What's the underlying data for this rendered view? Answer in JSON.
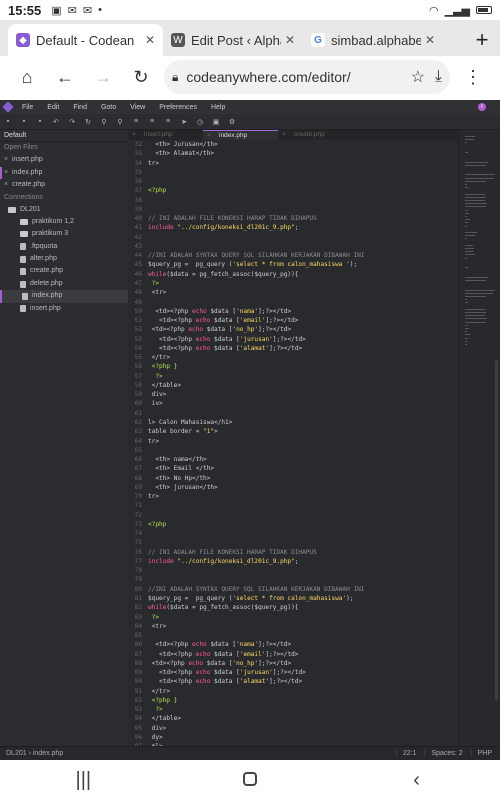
{
  "status": {
    "time": "15:55"
  },
  "tabs": [
    {
      "title": "Default - Codean",
      "active": true
    },
    {
      "title": "Edit Post ‹ Alpha"
    },
    {
      "title": "simbad.alphabe"
    }
  ],
  "url": "codeanywhere.com/editor/",
  "menu": [
    "File",
    "Edit",
    "Find",
    "Goto",
    "View",
    "Preferences",
    "Help"
  ],
  "sidebar": {
    "title": "Default",
    "open_files_label": "Open Files",
    "open_files": [
      "insert.php",
      "index.php",
      "create.php"
    ],
    "connections_label": "Connections",
    "tree": [
      {
        "label": "DL201",
        "kind": "folder",
        "indent": 8
      },
      {
        "label": "praktikum 1,2",
        "kind": "folder",
        "indent": 20
      },
      {
        "label": "praktikum 3",
        "kind": "folder",
        "indent": 20
      },
      {
        "label": ".ftpquota",
        "kind": "file",
        "indent": 20
      },
      {
        "label": "alter.php",
        "kind": "file",
        "indent": 20
      },
      {
        "label": "create.php",
        "kind": "file",
        "indent": 20
      },
      {
        "label": "delete.php",
        "kind": "file",
        "indent": 20
      },
      {
        "label": "index.php",
        "kind": "file",
        "indent": 20,
        "active": true
      },
      {
        "label": "insert.php",
        "kind": "file",
        "indent": 20
      }
    ]
  },
  "editor_tabs": [
    {
      "label": "insert.php"
    },
    {
      "label": "index.php",
      "active": true
    },
    {
      "label": "create.php"
    }
  ],
  "code_lines": [
    {
      "n": "32",
      "segs": [
        [
          "t",
          "  <th> Jurusan</th>"
        ]
      ]
    },
    {
      "n": "33",
      "segs": [
        [
          "t",
          "  <th> Alamat</th>"
        ]
      ]
    },
    {
      "n": "34",
      "segs": [
        [
          "t",
          "tr>"
        ]
      ]
    },
    {
      "n": "35",
      "segs": []
    },
    {
      "n": "36",
      "segs": []
    },
    {
      "n": "37",
      "segs": [
        [
          "p",
          "<?php"
        ]
      ]
    },
    {
      "n": "38",
      "segs": []
    },
    {
      "n": "39",
      "segs": []
    },
    {
      "n": "40",
      "segs": [
        [
          "c",
          "// INI ADALAH FILE KONEKSI HARAP TIDAK DIHAPUS"
        ]
      ]
    },
    {
      "n": "41",
      "segs": [
        [
          "k",
          "include"
        ],
        [
          "s",
          " \"../config/koneksi_dl201c_9.php\""
        ],
        [
          "t",
          ";"
        ]
      ]
    },
    {
      "n": "42",
      "segs": []
    },
    {
      "n": "43",
      "segs": []
    },
    {
      "n": "44",
      "segs": [
        [
          "c",
          "//INI ADALAH SYNTAX QUERY SQL SILAHKAN KERJAKAN DIBAWAH INI"
        ]
      ]
    },
    {
      "n": "45",
      "segs": [
        [
          "t",
          "$query_pg =  pg_query ("
        ],
        [
          "s",
          "'select * from calon_mahasiswa '"
        ],
        [
          "t",
          ");"
        ]
      ]
    },
    {
      "n": "46",
      "segs": [
        [
          "k",
          "while"
        ],
        [
          "t",
          "($data = pg_fetch_assoc($query_pg)){"
        ]
      ]
    },
    {
      "n": "47",
      "segs": [
        [
          "p",
          " ?>"
        ]
      ]
    },
    {
      "n": "48",
      "segs": [
        [
          "t",
          " <tr>"
        ]
      ]
    },
    {
      "n": "49",
      "segs": []
    },
    {
      "n": "50",
      "segs": [
        [
          "t",
          "  <td><?php "
        ],
        [
          "k",
          "echo"
        ],
        [
          "t",
          " $data ["
        ],
        [
          "s",
          "'nama'"
        ],
        [
          "t",
          "];?></td>"
        ]
      ]
    },
    {
      "n": "51",
      "segs": [
        [
          "t",
          "   <td><?php "
        ],
        [
          "k",
          "echo"
        ],
        [
          "t",
          " $data ["
        ],
        [
          "s",
          "'email'"
        ],
        [
          "t",
          "];?></td>"
        ]
      ]
    },
    {
      "n": "52",
      "segs": [
        [
          "t",
          " <td><?php "
        ],
        [
          "k",
          "echo"
        ],
        [
          "t",
          " $data ["
        ],
        [
          "s",
          "'no_hp'"
        ],
        [
          "t",
          "];?></td>"
        ]
      ]
    },
    {
      "n": "53",
      "segs": [
        [
          "t",
          "   <td><?php "
        ],
        [
          "k",
          "echo"
        ],
        [
          "t",
          " $data ["
        ],
        [
          "s",
          "'jurusan'"
        ],
        [
          "t",
          "];?></td>"
        ]
      ]
    },
    {
      "n": "54",
      "segs": [
        [
          "t",
          "   <td><?php "
        ],
        [
          "k",
          "echo"
        ],
        [
          "t",
          " $data ["
        ],
        [
          "s",
          "'alamat'"
        ],
        [
          "t",
          "];?></td>"
        ]
      ]
    },
    {
      "n": "55",
      "segs": [
        [
          "t",
          " </tr>"
        ]
      ]
    },
    {
      "n": "56",
      "segs": [
        [
          "p",
          " <?php }"
        ]
      ]
    },
    {
      "n": "57",
      "segs": [
        [
          "p",
          "  ?>"
        ]
      ]
    },
    {
      "n": "58",
      "segs": [
        [
          "t",
          " </table>"
        ]
      ]
    },
    {
      "n": "59",
      "segs": [
        [
          "t",
          " div>"
        ]
      ]
    },
    {
      "n": "60",
      "segs": [
        [
          "t",
          " iv>"
        ]
      ]
    },
    {
      "n": "61",
      "segs": []
    },
    {
      "n": "62",
      "segs": [
        [
          "t",
          "l> Calon Mahasiswa</h1>"
        ]
      ]
    },
    {
      "n": "63",
      "segs": [
        [
          "t",
          "table border = "
        ],
        [
          "s",
          "\"1\""
        ],
        [
          "t",
          ">"
        ]
      ]
    },
    {
      "n": "64",
      "segs": [
        [
          "t",
          "tr>"
        ]
      ]
    },
    {
      "n": "65",
      "segs": []
    },
    {
      "n": "66",
      "segs": [
        [
          "t",
          "  <th> nama</th>"
        ]
      ]
    },
    {
      "n": "67",
      "segs": [
        [
          "t",
          "  <th> Email </th>"
        ]
      ]
    },
    {
      "n": "68",
      "segs": [
        [
          "t",
          "  <th> No Hp</th>"
        ]
      ]
    },
    {
      "n": "69",
      "segs": [
        [
          "t",
          "  <th> jurusan</th>"
        ]
      ]
    },
    {
      "n": "70",
      "segs": [
        [
          "t",
          "tr>"
        ]
      ]
    },
    {
      "n": "71",
      "segs": []
    },
    {
      "n": "72",
      "segs": []
    },
    {
      "n": "73",
      "segs": [
        [
          "p",
          "<?php"
        ]
      ]
    },
    {
      "n": "74",
      "segs": []
    },
    {
      "n": "75",
      "segs": []
    },
    {
      "n": "76",
      "segs": [
        [
          "c",
          "// INI ADALAH FILE KONEKSI HARAP TIDAK DIHAPUS"
        ]
      ]
    },
    {
      "n": "77",
      "segs": [
        [
          "k",
          "include"
        ],
        [
          "s",
          " \"../config/koneksi_dl201c_9.php\""
        ],
        [
          "t",
          ";"
        ]
      ]
    },
    {
      "n": "78",
      "segs": []
    },
    {
      "n": "79",
      "segs": []
    },
    {
      "n": "80",
      "segs": [
        [
          "c",
          "//INI ADALAH SYNTAX QUERY SQL SILAHKAN KERJAKAN DIBAWAH INI"
        ]
      ]
    },
    {
      "n": "81",
      "segs": [
        [
          "t",
          "$query_pg =  pg_query ("
        ],
        [
          "s",
          "'select * from calon_mahasiswa'"
        ],
        [
          "t",
          ");"
        ]
      ]
    },
    {
      "n": "82",
      "segs": [
        [
          "k",
          "while"
        ],
        [
          "t",
          "($data = pg_fetch_assoc($query_pg)){"
        ]
      ]
    },
    {
      "n": "83",
      "segs": [
        [
          "p",
          " ?>"
        ]
      ]
    },
    {
      "n": "84",
      "segs": [
        [
          "t",
          " <tr>"
        ]
      ]
    },
    {
      "n": "85",
      "segs": []
    },
    {
      "n": "86",
      "segs": [
        [
          "t",
          "  <td><?php "
        ],
        [
          "k",
          "echo"
        ],
        [
          "t",
          " $data ["
        ],
        [
          "s",
          "'nama'"
        ],
        [
          "t",
          "];?></td>"
        ]
      ]
    },
    {
      "n": "87",
      "segs": [
        [
          "t",
          "   <td><?php "
        ],
        [
          "k",
          "echo"
        ],
        [
          "t",
          " $data ["
        ],
        [
          "s",
          "'email'"
        ],
        [
          "t",
          "];?></td>"
        ]
      ]
    },
    {
      "n": "88",
      "segs": [
        [
          "t",
          " <td><?php "
        ],
        [
          "k",
          "echo"
        ],
        [
          "t",
          " $data ["
        ],
        [
          "s",
          "'no_hp'"
        ],
        [
          "t",
          "];?></td>"
        ]
      ]
    },
    {
      "n": "89",
      "segs": [
        [
          "t",
          "   <td><?php "
        ],
        [
          "k",
          "echo"
        ],
        [
          "t",
          " $data ["
        ],
        [
          "s",
          "'jurusan'"
        ],
        [
          "t",
          "];?></td>"
        ]
      ]
    },
    {
      "n": "90",
      "segs": [
        [
          "t",
          "   <td><?php "
        ],
        [
          "k",
          "echo"
        ],
        [
          "t",
          " $data ["
        ],
        [
          "s",
          "'alamat'"
        ],
        [
          "t",
          "];?></td>"
        ]
      ]
    },
    {
      "n": "91",
      "segs": [
        [
          "t",
          " </tr>"
        ]
      ]
    },
    {
      "n": "92",
      "segs": [
        [
          "p",
          " <?php }"
        ]
      ]
    },
    {
      "n": "93",
      "segs": [
        [
          "p",
          "  ?>"
        ]
      ]
    },
    {
      "n": "94",
      "segs": [
        [
          "t",
          " </table>"
        ]
      ]
    },
    {
      "n": "95",
      "segs": [
        [
          "t",
          " div>"
        ]
      ]
    },
    {
      "n": "96",
      "segs": [
        [
          "t",
          " dy>"
        ]
      ]
    },
    {
      "n": "97",
      "segs": [
        [
          "t",
          " ml>"
        ]
      ]
    }
  ],
  "statusbar": {
    "path": "DL201 › index.php",
    "cursor": "22:1",
    "spaces": "Spaces: 2",
    "lang": "PHP"
  },
  "colors": {
    "accent": "#a35dd8",
    "keyword": "#ff5c93",
    "string": "#ffd966",
    "php": "#b3e34e",
    "comment": "#8d8d8d"
  }
}
